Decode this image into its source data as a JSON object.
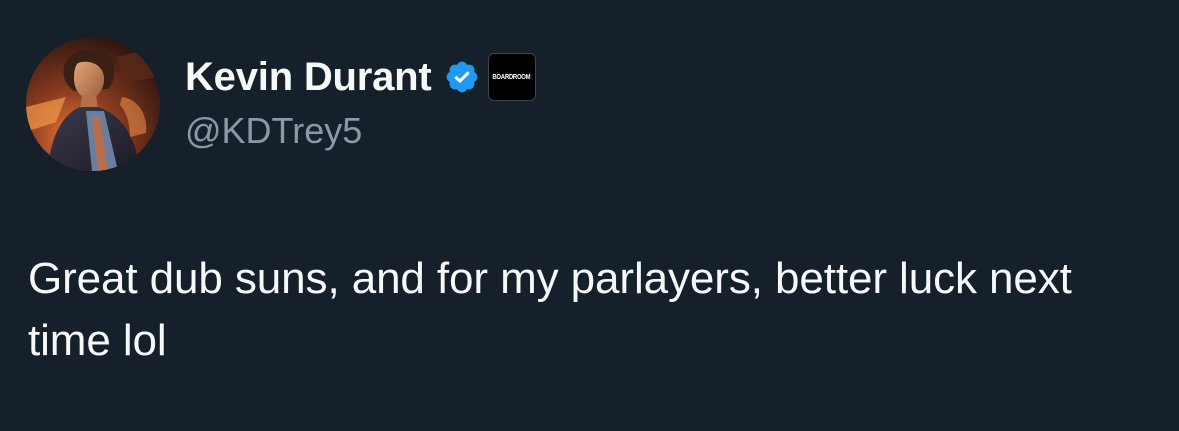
{
  "tweet": {
    "author": {
      "display_name": "Kevin Durant",
      "handle": "@KDTrey5",
      "verified": true,
      "verified_icon": "verified-badge-icon",
      "affiliate_badge_label": "BOARDROOM",
      "avatar_icon": "profile-avatar-image"
    },
    "text": "Great dub suns, and for my parlayers, better luck next time lol"
  },
  "theme": {
    "background": "#15202b",
    "text_primary": "#f7f9f9",
    "text_secondary": "#8b98a5",
    "verified_blue": "#1d9bf0"
  }
}
